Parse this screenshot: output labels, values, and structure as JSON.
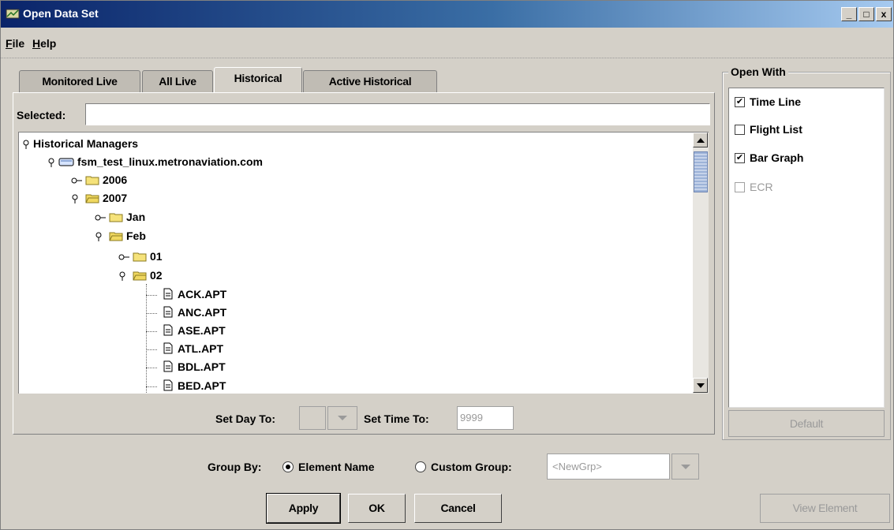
{
  "window": {
    "title": "Open Data Set",
    "controls": {
      "minimize": "_",
      "maximize": "□",
      "close": "x"
    }
  },
  "menu": [
    {
      "mnemonic": "F",
      "rest": "ile"
    },
    {
      "mnemonic": "H",
      "rest": "elp"
    }
  ],
  "tabs": [
    {
      "label": "Monitored Live",
      "active": false
    },
    {
      "label": "All Live",
      "active": false
    },
    {
      "label": "Historical",
      "active": true
    },
    {
      "label": "Active Historical",
      "active": false
    }
  ],
  "selected": {
    "label": "Selected:",
    "value": ""
  },
  "tree": {
    "root": "Historical Managers",
    "server": "fsm_test_linux.metronaviation.com",
    "years": [
      "2006",
      "2007"
    ],
    "months": [
      "Jan",
      "Feb"
    ],
    "days": [
      "01",
      "02"
    ],
    "files": [
      "ACK.APT",
      "ANC.APT",
      "ASE.APT",
      "ATL.APT",
      "BDL.APT",
      "BED.APT"
    ]
  },
  "set_day": {
    "label": "Set Day To:",
    "value": ""
  },
  "set_time": {
    "label": "Set Time To:",
    "value": "9999"
  },
  "group_by": {
    "label": "Group By:",
    "options": [
      {
        "label": "Element Name",
        "selected": true
      },
      {
        "label": "Custom Group:",
        "selected": false
      }
    ],
    "custom_value": "<NewGrp>"
  },
  "open_with": {
    "title": "Open With",
    "items": [
      {
        "label": "Time Line",
        "checked": true,
        "enabled": true
      },
      {
        "label": "Flight List",
        "checked": false,
        "enabled": true
      },
      {
        "label": "Bar Graph",
        "checked": true,
        "enabled": true
      },
      {
        "label": "ECR",
        "checked": false,
        "enabled": false
      }
    ],
    "default_button": "Default"
  },
  "buttons": {
    "apply": "Apply",
    "ok": "OK",
    "cancel": "Cancel",
    "view_element": "View Element"
  },
  "colors": {
    "window_bg": "#d4d0c8",
    "title_start": "#0a246a",
    "title_end": "#a6caf0",
    "folder": "#f5e27a",
    "thumb": "#9db3d8"
  }
}
